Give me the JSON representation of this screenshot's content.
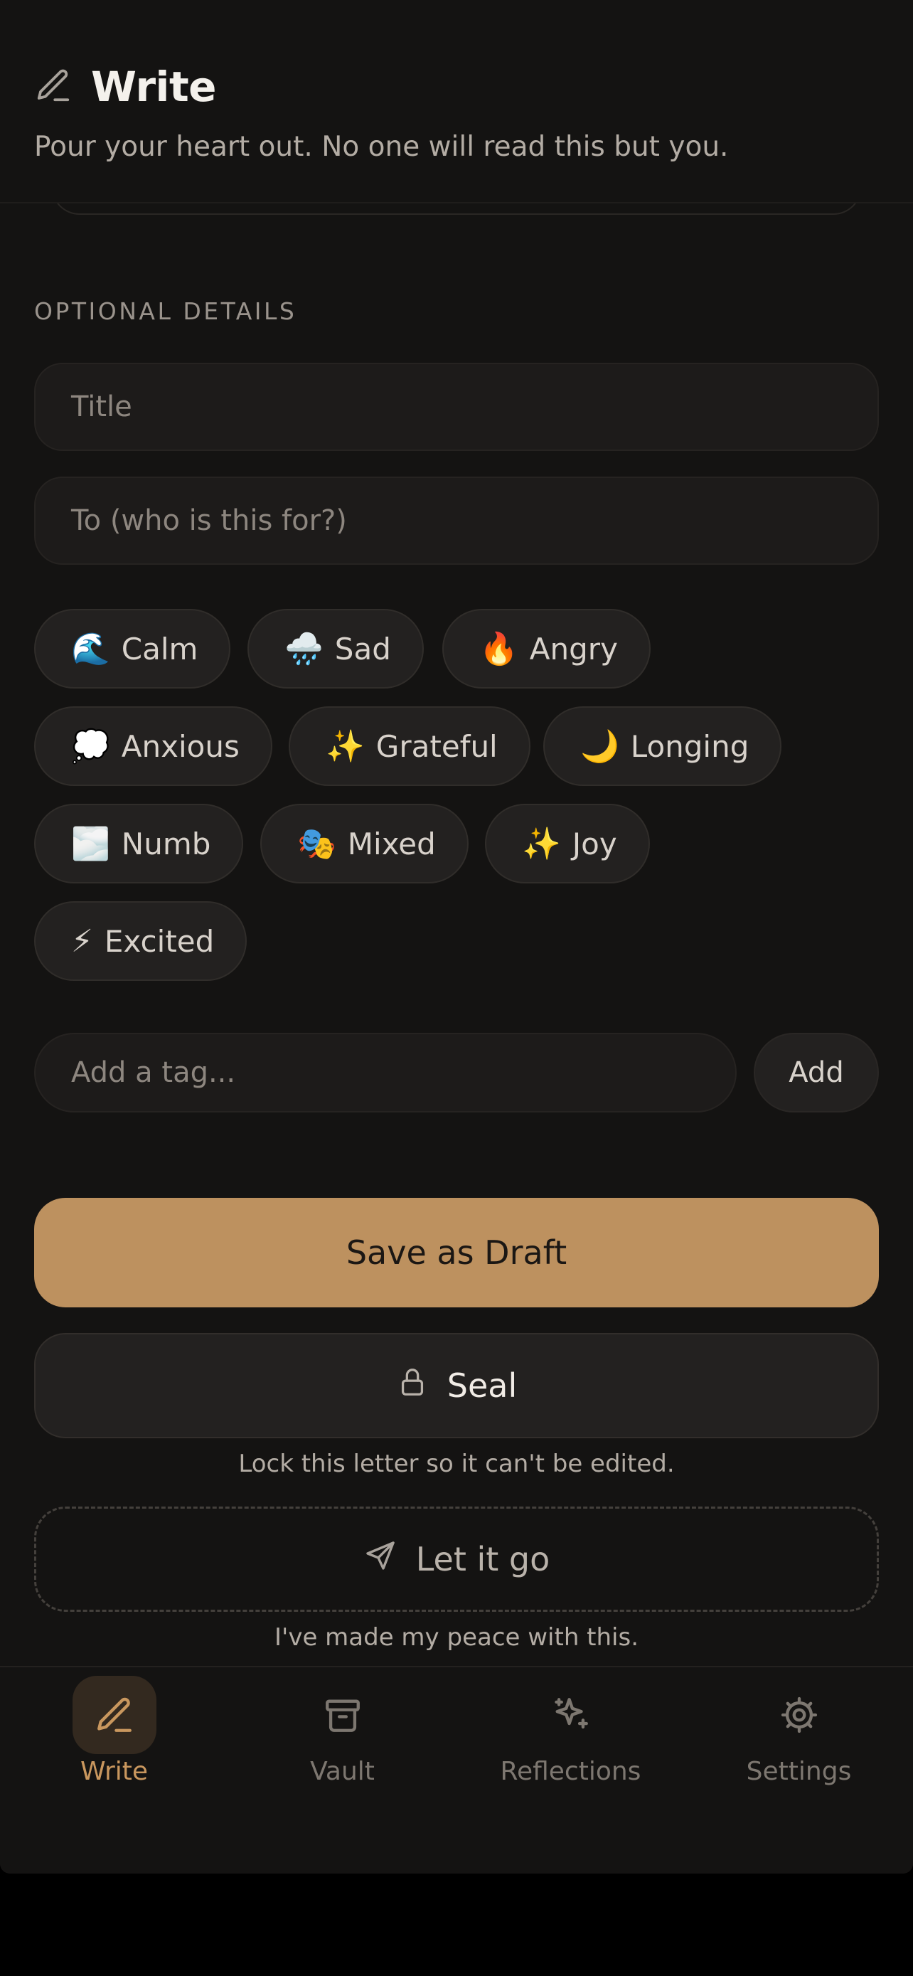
{
  "header": {
    "title": "Write",
    "subtitle": "Pour your heart out. No one will read this but you."
  },
  "details": {
    "section_label": "OPTIONAL DETAILS",
    "title_placeholder": "Title",
    "to_placeholder": "To (who is this for?)"
  },
  "moods": [
    {
      "emoji": "🌊",
      "label": "Calm"
    },
    {
      "emoji": "🌧️",
      "label": "Sad"
    },
    {
      "emoji": "🔥",
      "label": "Angry"
    },
    {
      "emoji": "💭",
      "label": "Anxious"
    },
    {
      "emoji": "✨",
      "label": "Grateful"
    },
    {
      "emoji": "🌙",
      "label": "Longing"
    },
    {
      "emoji": "🌫️",
      "label": "Numb"
    },
    {
      "emoji": "🎭",
      "label": "Mixed"
    },
    {
      "emoji": "✨",
      "label": "Joy"
    },
    {
      "emoji": "⚡",
      "label": "Excited"
    }
  ],
  "tags": {
    "placeholder": "Add a tag...",
    "add_label": "Add"
  },
  "actions": {
    "draft_label": "Save as Draft",
    "seal_label": "Seal",
    "seal_hint": "Lock this letter so it can't be edited.",
    "letgo_label": "Let it go",
    "letgo_hint": "I've made my peace with this."
  },
  "tabs": [
    {
      "label": "Write",
      "icon": "pen-icon",
      "active": true
    },
    {
      "label": "Vault",
      "icon": "archive-icon",
      "active": false
    },
    {
      "label": "Reflections",
      "icon": "sparkles-icon",
      "active": false
    },
    {
      "label": "Settings",
      "icon": "gear-icon",
      "active": false
    }
  ],
  "colors": {
    "background": "#141312",
    "accent": "#bd915f",
    "accent_text": "#c9975e"
  }
}
